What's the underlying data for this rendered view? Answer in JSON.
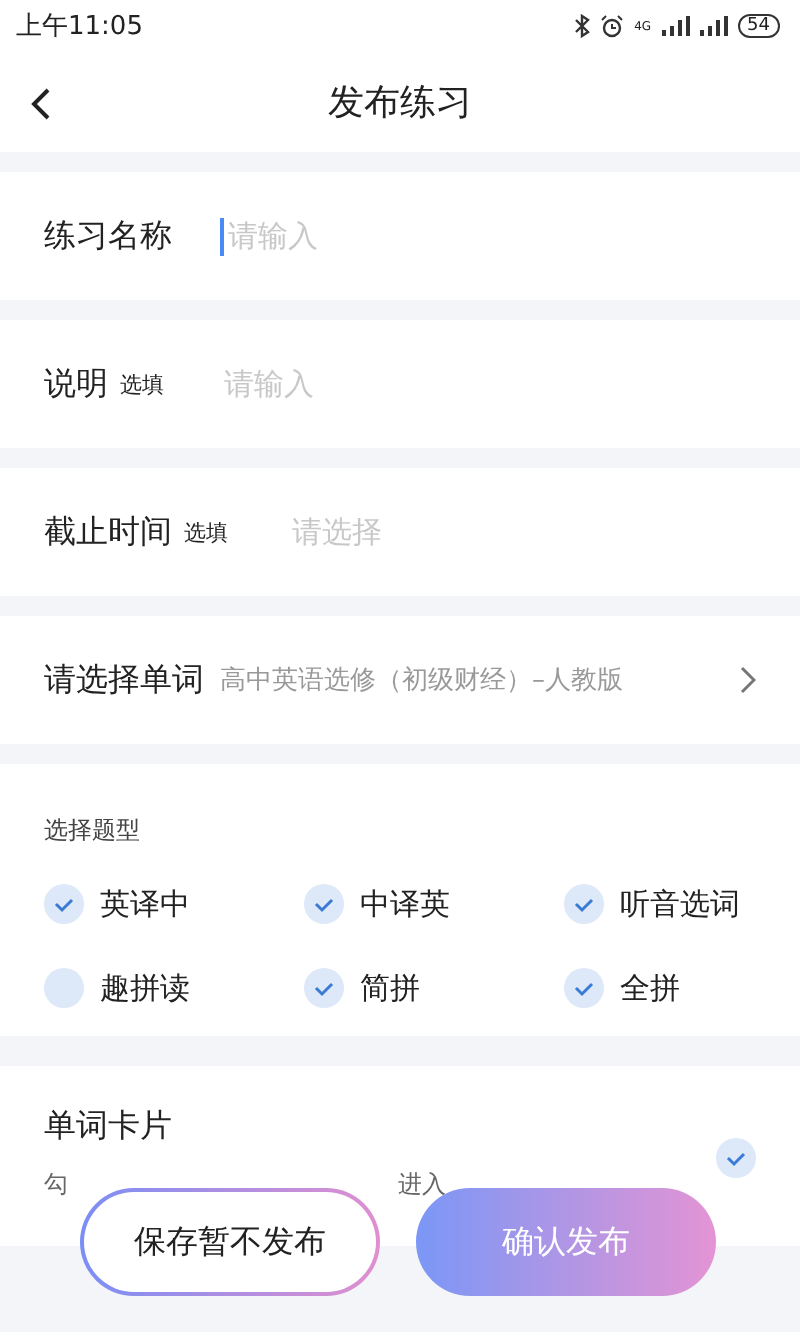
{
  "status_bar": {
    "time": "上午11:05",
    "network": "4G",
    "battery": "54"
  },
  "header": {
    "title": "发布练习"
  },
  "fields": [
    {
      "kind": "input",
      "label": "练习名称",
      "placeholder": "请输入",
      "focused": true
    },
    {
      "kind": "input",
      "label": "说明",
      "tag": "选填",
      "placeholder": "请输入",
      "focused": false
    },
    {
      "kind": "picker",
      "label": "截止时间",
      "tag": "选填",
      "placeholder": "请选择"
    },
    {
      "kind": "link",
      "label": "请选择单词",
      "value": "高中英语选修（初级财经）–人教版"
    }
  ],
  "question_types": {
    "title": "选择题型",
    "options": [
      {
        "label": "英译中",
        "checked": true
      },
      {
        "label": "中译英",
        "checked": true
      },
      {
        "label": "听音选词",
        "checked": true
      },
      {
        "label": "趣拼读",
        "checked": false
      },
      {
        "label": "简拼",
        "checked": true
      },
      {
        "label": "全拼",
        "checked": true
      }
    ]
  },
  "word_card": {
    "title": "单词卡片",
    "description_start": "勾",
    "description_end": "进入",
    "checked": true
  },
  "buttons": [
    {
      "kind": "outline",
      "label": "保存暂不发布"
    },
    {
      "kind": "primary",
      "label": "确认发布"
    }
  ]
}
